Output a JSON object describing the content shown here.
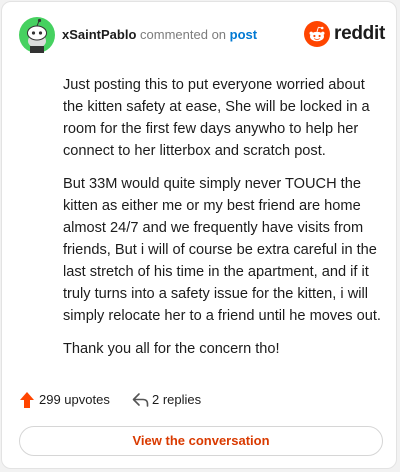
{
  "comment": {
    "username": "xSaintPablo",
    "commented_text": "commented on",
    "post_link": "post",
    "brand": "reddit",
    "paragraphs": [
      "Just posting this to put everyone worried about the kitten safety at ease, She will be locked in a room for the first few days anywho to help her connect to her litterbox and scratch post.",
      "But 33M would quite simply never TOUCH the kitten as either me or my best friend are home almost 24/7 and we frequently have visits from friends, But i will of course be extra careful in the last stretch of his time in the apartment, and if it truly turns into a safety issue for the kitten, i will simply relocate her to a friend until he moves out.",
      "Thank you all for the concern tho!"
    ],
    "upvotes": "299 upvotes",
    "replies": "2 replies",
    "view_button": "View the conversation"
  },
  "colors": {
    "accent": "#d93a00",
    "link": "#0079d3",
    "reddit_orange": "#ff4500",
    "avatar_green": "#46d160",
    "upvote": "#ff4500"
  },
  "icons": {
    "avatar": "snoo-avatar-icon",
    "logo": "reddit-logo-icon",
    "upvote": "upvote-arrow-icon",
    "reply": "reply-arrow-icon"
  }
}
